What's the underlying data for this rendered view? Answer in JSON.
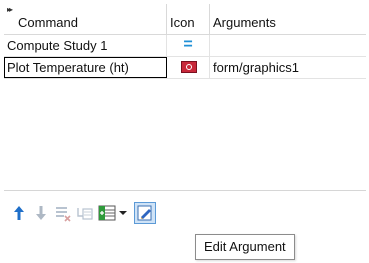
{
  "table": {
    "headers": {
      "command": "Command",
      "icon": "Icon",
      "arguments": "Arguments"
    },
    "rows": [
      {
        "command": "Compute Study 1",
        "icon": "equals-icon",
        "arguments": "",
        "selected": false
      },
      {
        "command": "Plot Temperature (ht)",
        "icon": "plot-icon",
        "arguments": "form/graphics1",
        "selected": true
      }
    ]
  },
  "toolbar": {
    "buttons": [
      {
        "name": "move-up-icon",
        "enabled": true
      },
      {
        "name": "move-down-icon",
        "enabled": false
      },
      {
        "name": "delete-icon",
        "enabled": false
      },
      {
        "name": "clear-table-icon",
        "enabled": false
      },
      {
        "name": "add-command-icon",
        "enabled": true
      },
      {
        "name": "dropdown-arrow-icon",
        "enabled": true
      },
      {
        "name": "edit-argument-icon",
        "enabled": true,
        "active": true
      }
    ]
  },
  "tooltip": {
    "text": "Edit Argument"
  },
  "colors": {
    "accent": "#1f8fd6",
    "plot_icon": "#c8283a",
    "active_button_border": "#5c9ad6"
  }
}
